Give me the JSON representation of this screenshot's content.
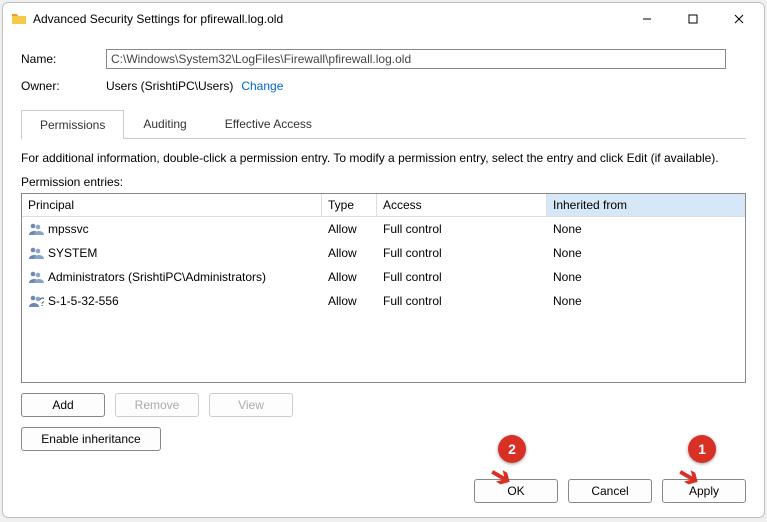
{
  "window": {
    "title": "Advanced Security Settings for pfirewall.log.old"
  },
  "fields": {
    "name_label": "Name:",
    "name_value": "C:\\Windows\\System32\\LogFiles\\Firewall\\pfirewall.log.old",
    "owner_label": "Owner:",
    "owner_value": "Users (SrishtiPC\\Users)",
    "change_link": "Change"
  },
  "tabs": {
    "permissions": "Permissions",
    "auditing": "Auditing",
    "effective": "Effective Access"
  },
  "info_text": "For additional information, double-click a permission entry. To modify a permission entry, select the entry and click Edit (if available).",
  "entries_label": "Permission entries:",
  "columns": {
    "principal": "Principal",
    "type": "Type",
    "access": "Access",
    "inherited": "Inherited from"
  },
  "entries": [
    {
      "icon": "group",
      "principal": "mpssvc",
      "type": "Allow",
      "access": "Full control",
      "inherited": "None"
    },
    {
      "icon": "group",
      "principal": "SYSTEM",
      "type": "Allow",
      "access": "Full control",
      "inherited": "None"
    },
    {
      "icon": "group",
      "principal": "Administrators (SrishtiPC\\Administrators)",
      "type": "Allow",
      "access": "Full control",
      "inherited": "None"
    },
    {
      "icon": "unknown",
      "principal": "S-1-5-32-556",
      "type": "Allow",
      "access": "Full control",
      "inherited": "None"
    }
  ],
  "buttons": {
    "add": "Add",
    "remove": "Remove",
    "view": "View",
    "enable_inheritance": "Enable inheritance",
    "ok": "OK",
    "cancel": "Cancel",
    "apply": "Apply"
  },
  "annotations": {
    "badge1": "1",
    "badge2": "2"
  }
}
